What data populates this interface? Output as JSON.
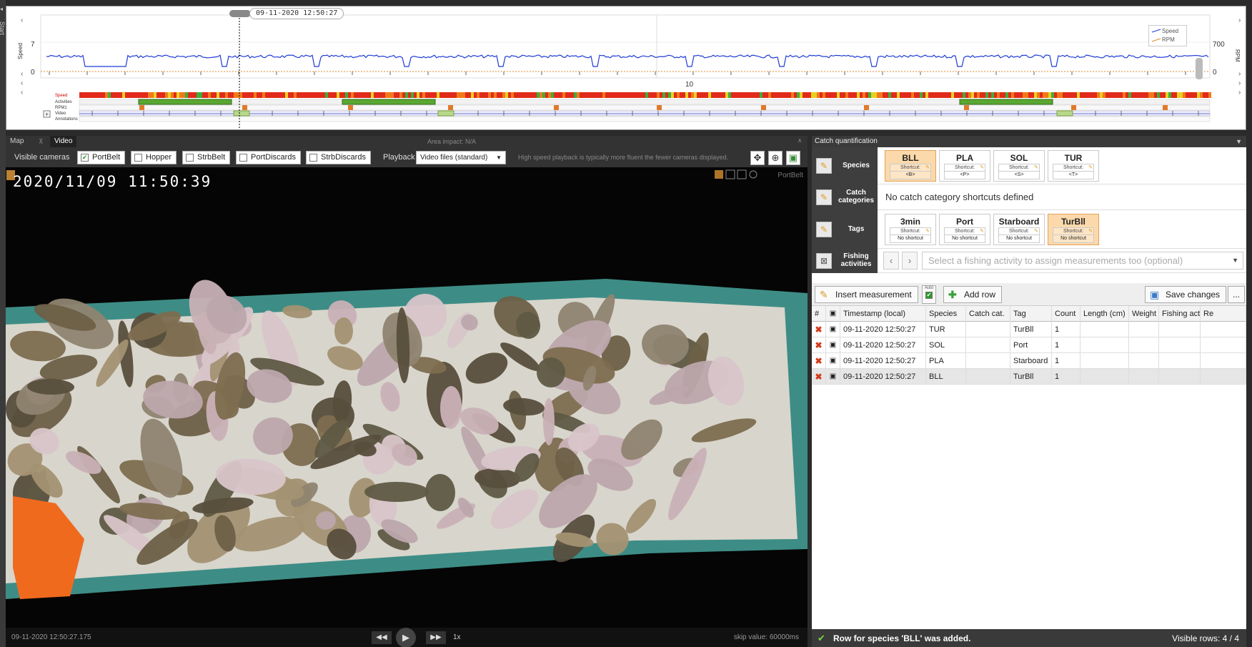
{
  "sidebar": {
    "start_label": "Start"
  },
  "timeline": {
    "cursor_time": "09-11-2020 12:50:27",
    "left_axis_label": "Speed",
    "right_axis_label": "RPM",
    "left_tick_top": "7",
    "left_tick_bottom": "0",
    "right_tick_top": "700",
    "right_tick_bottom": "0",
    "x_tick_label": "10",
    "legend": [
      "Speed",
      "RPM"
    ],
    "track_labels": [
      "Speed",
      "Activities",
      "RPM1",
      "Video",
      "Annotations"
    ],
    "colors": {
      "speed": "#1f3bd6",
      "rpm": "#e38a2a",
      "activity": "#5aa832",
      "video_bar": "#9ab0e0"
    }
  },
  "video_panel": {
    "tabs": [
      "Map",
      "Video"
    ],
    "area_impact": "Area impact: N/A",
    "visible_cameras_label": "Visible cameras",
    "cameras": [
      {
        "name": "PortBelt",
        "checked": true
      },
      {
        "name": "Hopper",
        "checked": false
      },
      {
        "name": "StrbBelt",
        "checked": false
      },
      {
        "name": "PortDiscards",
        "checked": false
      },
      {
        "name": "StrbDiscards",
        "checked": false
      }
    ],
    "playback_label": "Playback",
    "playback_value": "Video files (standard)",
    "high_speed_note": "High speed playback is typically more fluent the fewer cameras displayed.",
    "overlay_timestamp": "2020/11/09 11:50:39",
    "camera_overlay_label": "PortBelt",
    "footer_time": "09-11-2020 12:50:27.175",
    "speed_label": "1x",
    "skip_value": "skip value: 60000ms"
  },
  "catch_panel": {
    "title": "Catch quantification",
    "species_label": "Species",
    "species": [
      {
        "code": "BLL",
        "shortcut_label": "Shortcut:",
        "key": "<B>",
        "selected": true
      },
      {
        "code": "PLA",
        "shortcut_label": "Shortcut:",
        "key": "<P>",
        "selected": false
      },
      {
        "code": "SOL",
        "shortcut_label": "Shortcut:",
        "key": "<S>",
        "selected": false
      },
      {
        "code": "TUR",
        "shortcut_label": "Shortcut:",
        "key": "<T>",
        "selected": false
      }
    ],
    "catch_categories_label": "Catch categories",
    "catch_categories_info": "No catch category shortcuts defined",
    "tags_label": "Tags",
    "tags": [
      {
        "code": "3min",
        "shortcut_label": "Shortcut:",
        "key": "No shortcut",
        "selected": false
      },
      {
        "code": "Port",
        "shortcut_label": "Shortcut:",
        "key": "No shortcut",
        "selected": false
      },
      {
        "code": "Starboard",
        "shortcut_label": "Shortcut:",
        "key": "No shortcut",
        "selected": false
      },
      {
        "code": "TurBll",
        "shortcut_label": "Shortcut:",
        "key": "No shortcut",
        "selected": true
      }
    ],
    "fishing_activities_label": "Fishing activities",
    "fishing_activity_placeholder": "Select a fishing activity to assign measurements too (optional)",
    "insert_measurement": "Insert measurement",
    "auto_label": "Auto",
    "add_row": "Add row",
    "save_changes": "Save changes",
    "more": "...",
    "columns": [
      "#",
      "",
      "Timestamp (local)",
      "Species",
      "Catch cat.",
      "Tag",
      "Count",
      "Length (cm)",
      "Weight",
      "Fishing act",
      "Re"
    ],
    "rows": [
      {
        "timestamp": "09-11-2020 12:50:27",
        "species": "TUR",
        "catch_cat": "",
        "tag": "TurBll",
        "count": "1"
      },
      {
        "timestamp": "09-11-2020 12:50:27",
        "species": "SOL",
        "catch_cat": "",
        "tag": "Port",
        "count": "1"
      },
      {
        "timestamp": "09-11-2020 12:50:27",
        "species": "PLA",
        "catch_cat": "",
        "tag": "Starboard",
        "count": "1"
      },
      {
        "timestamp": "09-11-2020 12:50:27",
        "species": "BLL",
        "catch_cat": "",
        "tag": "TurBll",
        "count": "1"
      }
    ],
    "status_message": "Row for species 'BLL' was added.",
    "visible_rows": "Visible rows: 4 / 4"
  }
}
